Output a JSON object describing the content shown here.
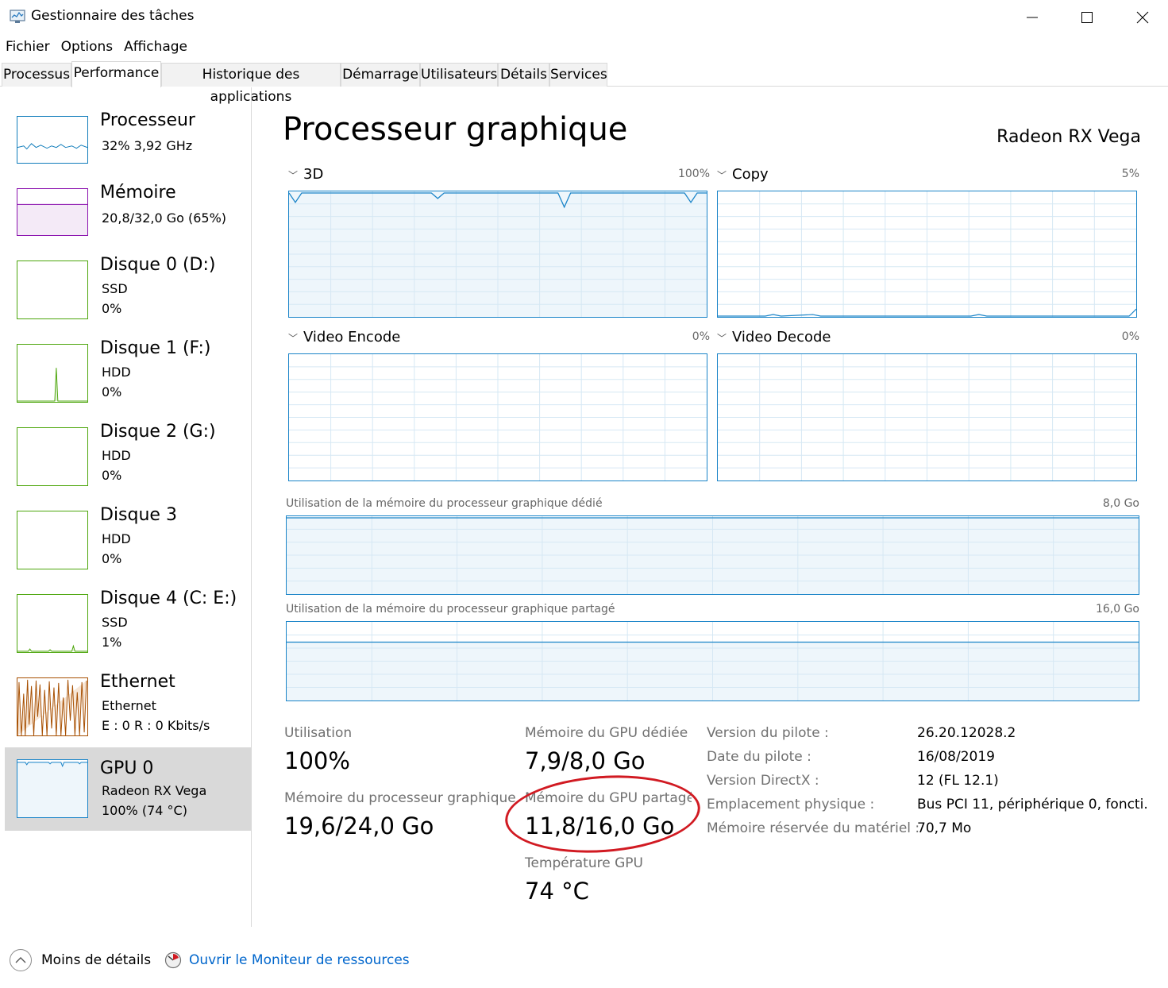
{
  "window": {
    "title": "Gestionnaire des tâches",
    "icons": {
      "app": "task-manager-icon",
      "minimize": "minimize-icon",
      "maximize": "maximize-icon",
      "close": "close-icon"
    }
  },
  "menu": [
    "Fichier",
    "Options",
    "Affichage"
  ],
  "tabs": [
    "Processus",
    "Performance",
    "Historique des applications",
    "Démarrage",
    "Utilisateurs",
    "Détails",
    "Services"
  ],
  "active_tab": "Performance",
  "sidebar": [
    {
      "title": "Processeur",
      "line1": "32%  3,92 GHz",
      "line2": ""
    },
    {
      "title": "Mémoire",
      "line1": "20,8/32,0 Go (65%)",
      "line2": ""
    },
    {
      "title": "Disque 0 (D:)",
      "line1": "SSD",
      "line2": "0%"
    },
    {
      "title": "Disque 1 (F:)",
      "line1": "HDD",
      "line2": "0%"
    },
    {
      "title": "Disque 2 (G:)",
      "line1": "HDD",
      "line2": "0%"
    },
    {
      "title": "Disque 3",
      "line1": "HDD",
      "line2": "0%"
    },
    {
      "title": "Disque 4 (C: E:)",
      "line1": "SSD",
      "line2": "1%"
    },
    {
      "title": "Ethernet",
      "line1": "Ethernet",
      "line2": "E : 0  R : 0 Kbits/s"
    },
    {
      "title": "GPU 0",
      "line1": "Radeon RX Vega",
      "line2": "100%  (74 °C)"
    }
  ],
  "colors": {
    "cpu": "#117dbb",
    "memory": "#8b12ae",
    "disk": "#4da60c",
    "ethernet": "#a74f01",
    "gpu": "#1a84c8",
    "selected": "#d9d9d9",
    "link": "#0066cc",
    "annotation": "#d11a22"
  },
  "main": {
    "title": "Processeur graphique",
    "gpu_name": "Radeon RX Vega",
    "engines": [
      {
        "name": "3D",
        "max": "100%"
      },
      {
        "name": "Copy",
        "max": "5%"
      },
      {
        "name": "Video Encode",
        "max": "0%"
      },
      {
        "name": "Video Decode",
        "max": "0%"
      }
    ],
    "dedicated_mem_label": "Utilisation de la mémoire du processeur graphique dédié",
    "dedicated_mem_max": "8,0 Go",
    "shared_mem_label": "Utilisation de la mémoire du processeur graphique partagé",
    "shared_mem_max": "16,0 Go"
  },
  "stats": {
    "utilisation_label": "Utilisation",
    "utilisation_value": "100%",
    "gpu_memory_label": "Mémoire du processeur graphique",
    "gpu_memory_value": "19,6/24,0 Go",
    "dedicated_label": "Mémoire du GPU dédiée",
    "dedicated_value": "7,9/8,0 Go",
    "shared_label": "Mémoire du GPU partagée",
    "shared_value": "11,8/16,0 Go",
    "temp_label": "Température GPU",
    "temp_value": "74 °C"
  },
  "info": [
    {
      "label": "Version du pilote :",
      "value": "26.20.12028.2"
    },
    {
      "label": "Date du pilote :",
      "value": "16/08/2019"
    },
    {
      "label": "Version DirectX :",
      "value": "12 (FL 12.1)"
    },
    {
      "label": "Emplacement physique :",
      "value": "Bus PCI 11, périphérique 0, foncti..."
    },
    {
      "label": "Mémoire réservée du matériel :",
      "value": "70,7 Mo"
    }
  ],
  "footer": {
    "less_details": "Moins de détails",
    "open_monitor": "Ouvrir le Moniteur de ressources"
  }
}
